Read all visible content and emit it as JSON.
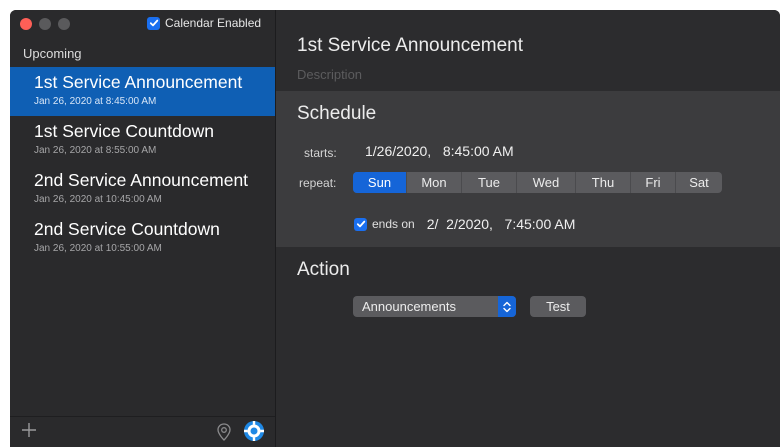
{
  "sidebar": {
    "calendar_enabled": {
      "label": "Calendar Enabled",
      "checked": true
    },
    "section_label": "Upcoming",
    "events": [
      {
        "title": "1st Service Announcement",
        "date": "Jan 26, 2020 at 8:45:00 AM",
        "selected": true
      },
      {
        "title": "1st Service Countdown",
        "date": "Jan 26, 2020 at 8:55:00 AM",
        "selected": false
      },
      {
        "title": "2nd Service Announcement",
        "date": "Jan 26, 2020 at 10:45:00 AM",
        "selected": false
      },
      {
        "title": "2nd Service Countdown",
        "date": "Jan 26, 2020 at 10:55:00 AM",
        "selected": false
      }
    ],
    "footer": {
      "add_icon": "plus-icon",
      "location_icon": "location-pin-icon",
      "help_icon": "lifebuoy-icon"
    }
  },
  "detail": {
    "title": "1st Service Announcement",
    "description_placeholder": "Description",
    "schedule": {
      "heading": "Schedule",
      "starts_label": "starts:",
      "starts_value": "1/26/2020,   8:45:00 AM",
      "repeat_label": "repeat:",
      "days": [
        {
          "label": "Sun",
          "on": true
        },
        {
          "label": "Mon",
          "on": false
        },
        {
          "label": "Tue",
          "on": false
        },
        {
          "label": "Wed",
          "on": false
        },
        {
          "label": "Thu",
          "on": false
        },
        {
          "label": "Fri",
          "on": false
        },
        {
          "label": "Sat",
          "on": false
        }
      ],
      "ends_label": "ends on",
      "ends_checked": true,
      "ends_value": "2/  2/2020,   7:45:00 AM"
    },
    "action": {
      "heading": "Action",
      "selected_action": "Announcements",
      "test_label": "Test"
    }
  },
  "colors": {
    "accent": "#1565d8",
    "selection": "#0f5fb4",
    "close": "#fe5f57"
  }
}
